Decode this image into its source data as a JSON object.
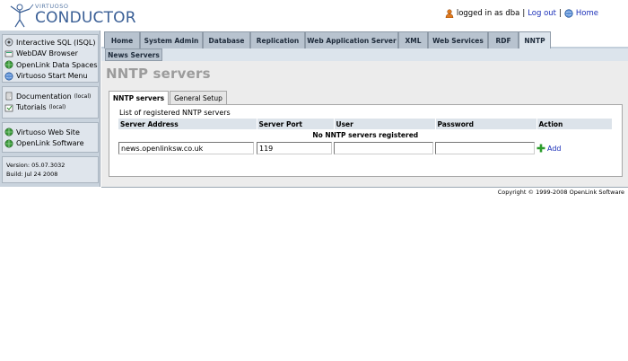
{
  "header": {
    "logo_small": "VIRTUOSO",
    "logo_big": "CONDUCTOR",
    "logged_in_text": "logged in as dba",
    "separator": "|",
    "logout_label": "Log out",
    "home_label": "Home"
  },
  "sidebar": {
    "group1": [
      {
        "label": "Interactive SQL (ISQL)",
        "icon": "isql-icon"
      },
      {
        "label": "WebDAV Browser",
        "icon": "webdav-icon"
      },
      {
        "label": "OpenLink Data Spaces",
        "icon": "dataspaces-icon"
      },
      {
        "label": "Virtuoso Start Menu",
        "icon": "globe-icon"
      }
    ],
    "group2": [
      {
        "label": "Documentation",
        "small": "(local)",
        "icon": "document-icon"
      },
      {
        "label": "Tutorials",
        "small": "(local)",
        "icon": "tutorial-icon"
      }
    ],
    "group3": [
      {
        "label": "Virtuoso Web Site",
        "icon": "globe-icon"
      },
      {
        "label": "OpenLink Software",
        "icon": "globe-icon"
      }
    ],
    "version": "Version: 05.07.3032",
    "build": "Build: Jul 24 2008"
  },
  "tabs": [
    "Home",
    "System Admin",
    "Database",
    "Replication",
    "Web Application Server",
    "XML",
    "Web Services",
    "RDF",
    "NNTP"
  ],
  "active_tab": "NNTP",
  "subtab": "News Servers",
  "main": {
    "title": "NNTP servers",
    "inner_tabs": [
      "NNTP servers",
      "General Setup"
    ],
    "caption": "List of registered NNTP servers",
    "columns": [
      "Server Address",
      "Server Port",
      "User",
      "Password",
      "Action"
    ],
    "empty_message": "No NNTP servers registered",
    "form": {
      "address_value": "news.openlinksw.co.uk",
      "port_value": "119",
      "user_value": "",
      "password_value": "",
      "add_label": "Add"
    }
  },
  "footer": {
    "copyright": "Copyright © 1999-2008 OpenLink Software"
  },
  "colors": {
    "link": "#1a2fb8",
    "tab_bg": "#b8c3cf",
    "sidebar_bg": "#c9d3dd",
    "title_gray": "#9c9c9c"
  }
}
